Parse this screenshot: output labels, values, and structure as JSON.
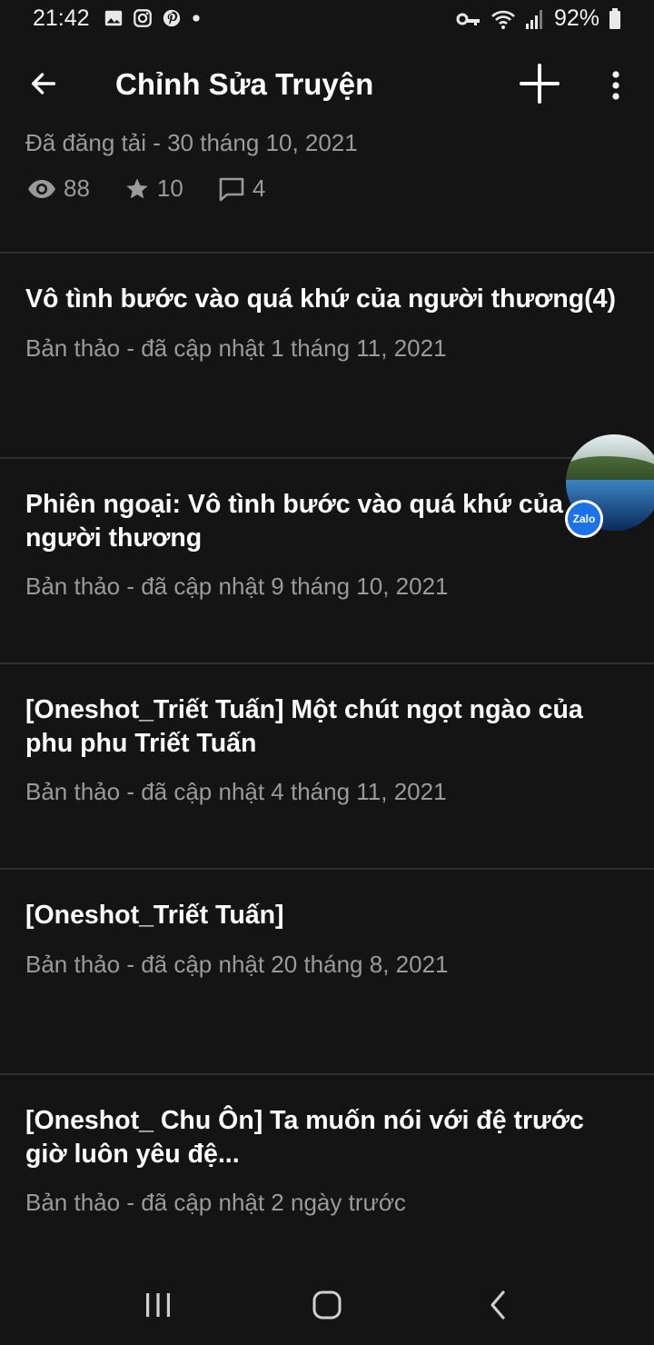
{
  "status_bar": {
    "time": "21:42",
    "left_icons": [
      "image-icon",
      "instagram-icon",
      "pinterest-icon",
      "dot-icon"
    ],
    "right_icons": [
      "vpn-key-icon",
      "wifi-icon",
      "signal-icon",
      "battery-icon"
    ],
    "battery": "92%"
  },
  "app_bar": {
    "title": "Chỉnh Sửa Truyện",
    "back_icon": "arrow-left-icon",
    "add_icon": "plus-icon",
    "more_icon": "more-vert-icon"
  },
  "published_item": {
    "subtitle": "Đã đăng tải - 30 tháng 10, 2021",
    "views": "88",
    "votes": "10",
    "comments": "4"
  },
  "stories": [
    {
      "title": "Vô tình bước vào quá khứ của người thương(4)",
      "subtitle": "Bản thảo - đã cập nhật 1 tháng 11, 2021"
    },
    {
      "title": "Phiên ngoại: Vô tình bước vào quá khứ của người thương",
      "subtitle": "Bản thảo - đã cập nhật 9 tháng 10, 2021"
    },
    {
      "title": "[Oneshot_Triết Tuấn] Một chút ngọt ngào của phu phu Triết Tuấn",
      "subtitle": "Bản thảo - đã cập nhật 4 tháng 11, 2021"
    },
    {
      "title": "[Oneshot_Triết Tuấn]",
      "subtitle": "Bản thảo - đã cập nhật 20 tháng 8, 2021"
    },
    {
      "title": "[Oneshot_ Chu Ôn] Ta muốn nói với đệ trước giờ luôn yêu đệ...",
      "subtitle": "Bản thảo - đã cập nhật 2 ngày trước"
    }
  ],
  "chat_bubble": {
    "badge": "Zalo"
  },
  "nav_bar": {
    "buttons": [
      "recent-apps-icon",
      "home-icon",
      "back-icon"
    ]
  },
  "colors": {
    "background": "#141414",
    "text": "#ffffff",
    "secondary_text": "#9a9a9a",
    "divider": "#2e2e2e"
  }
}
